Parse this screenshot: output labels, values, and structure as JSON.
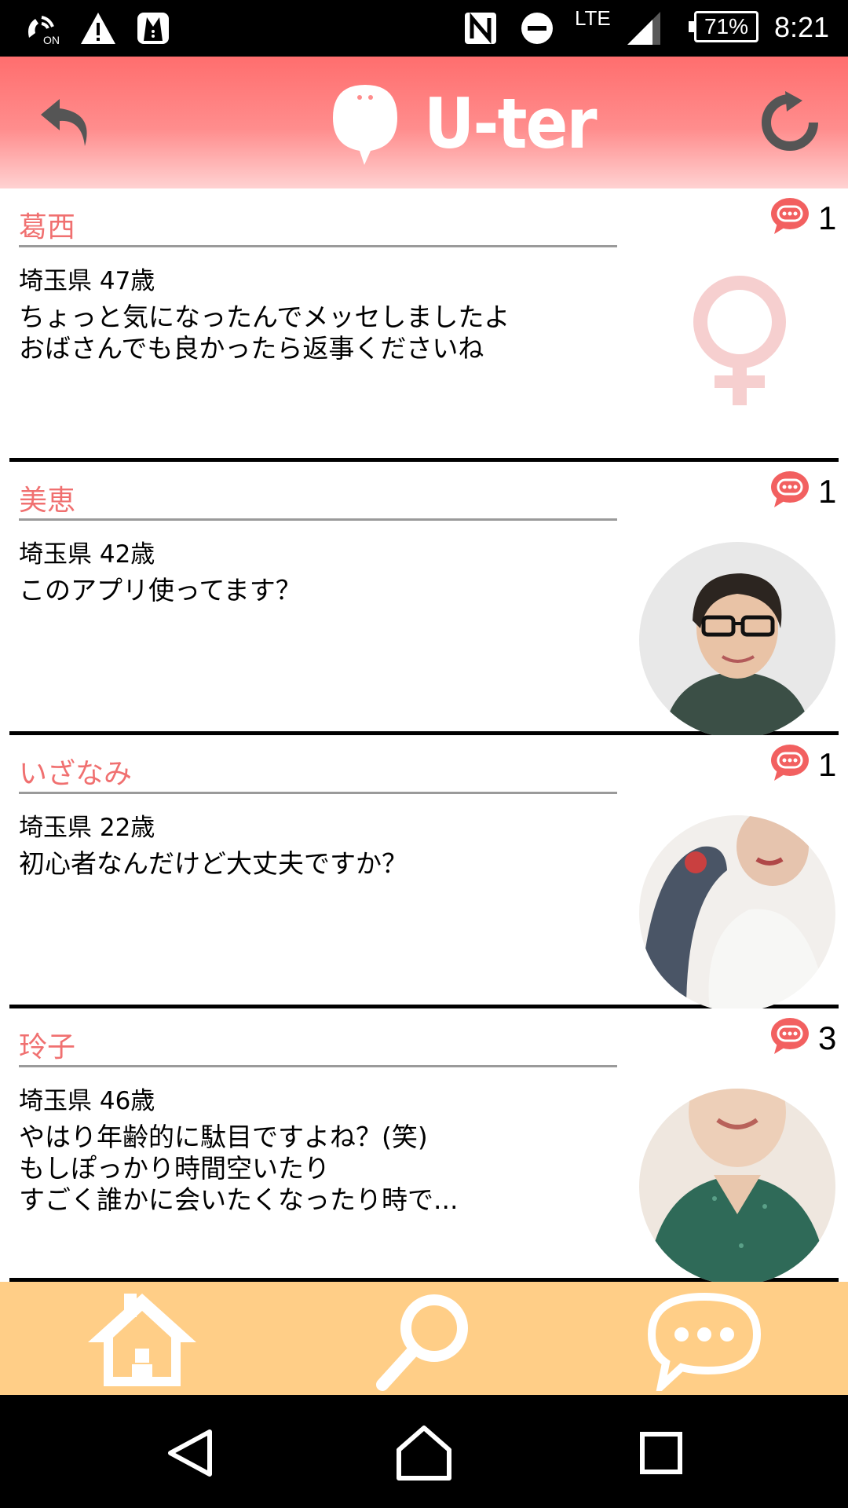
{
  "status_bar": {
    "time": "8:21",
    "battery": "71%",
    "network": "LTE",
    "icons": [
      "wifi-calling-icon",
      "warning-icon",
      "tuxedo-icon",
      "nfc-icon",
      "do-not-disturb-icon",
      "signal-icon",
      "battery-icon"
    ]
  },
  "header": {
    "logo_text": "U-ter",
    "back_icon": "back-arrow-icon",
    "refresh_icon": "refresh-icon",
    "colors": {
      "gradient_top": "#ff6e6e",
      "gradient_bottom": "#ffd2d2"
    }
  },
  "messages": [
    {
      "name": "葛西",
      "meta": "埼玉県 47歳",
      "text": "ちょっと気になったんでメッセしましたよ\nおばさんでも良かったら返事くださいね",
      "count": "1",
      "avatar": "female-symbol-icon"
    },
    {
      "name": "美恵",
      "meta": "埼玉県 42歳",
      "text": "このアプリ使ってます？",
      "count": "1",
      "avatar": "user-photo"
    },
    {
      "name": "いざなみ",
      "meta": "埼玉県 22歳",
      "text": "初心者なんだけど大丈夫ですか？",
      "count": "1",
      "avatar": "user-photo"
    },
    {
      "name": "玲子",
      "meta": "埼玉県 46歳",
      "text": "やはり年齢的に駄目ですよね？(笑)\nもしぽっかり時間空いたり\nすごく誰かに会いたくなったり時で...",
      "count": "3",
      "avatar": "user-photo"
    }
  ],
  "bottom_nav": {
    "items": [
      "home-icon",
      "search-icon",
      "chat-icon"
    ],
    "background": "#ffce87"
  },
  "system_nav": {
    "items": [
      "back-icon",
      "home-icon",
      "recents-icon"
    ]
  },
  "colors": {
    "accent": "#f07070",
    "badge": "#f26060"
  }
}
